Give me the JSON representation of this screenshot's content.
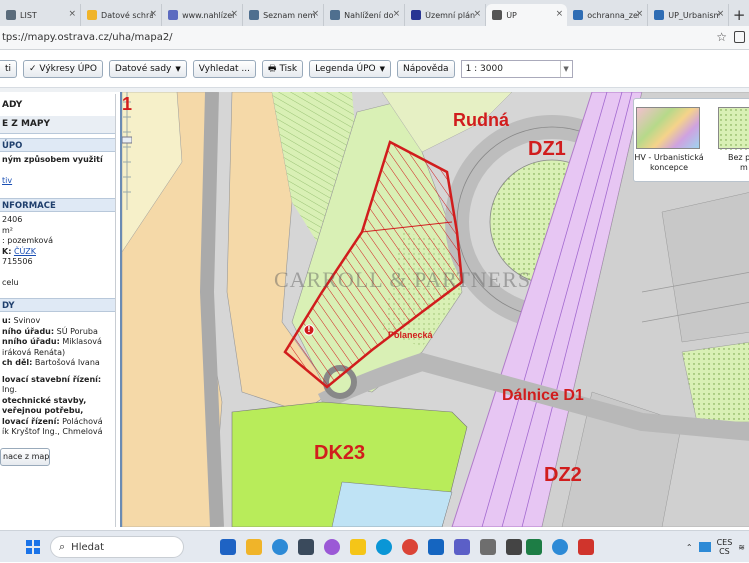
{
  "browser": {
    "tabs": [
      {
        "label": "LIST",
        "color": "#5a6b7b",
        "active": false
      },
      {
        "label": "Datové schrán",
        "color": "#f0b429",
        "active": false
      },
      {
        "label": "www.nahlízen",
        "color": "#5c6bc0",
        "active": false
      },
      {
        "label": "Seznam nemo",
        "color": "#4f6f8f",
        "active": false
      },
      {
        "label": "Nahlížení do k",
        "color": "#4f6f8f",
        "active": false
      },
      {
        "label": "Územní plán C",
        "color": "#283593",
        "active": false
      },
      {
        "label": "ÚP",
        "color": "#555555",
        "active": true
      },
      {
        "label": "ochranna_zele",
        "color": "#2f6db4",
        "active": false
      },
      {
        "label": "UP_Urbanism",
        "color": "#2f6db4",
        "active": false
      }
    ],
    "new_tab": "+",
    "url": "tps://mapy.ostrava.cz/uha/mapa2/"
  },
  "toolbar": {
    "buttons": [
      {
        "label": "ti",
        "has_caret": false
      },
      {
        "label": "✓ Výkresy ÚPO",
        "has_caret": false
      },
      {
        "label": "Datové sady",
        "has_caret": true
      },
      {
        "label": "Vyhledat ...",
        "has_caret": false
      },
      {
        "label": "Tisk",
        "has_caret": false,
        "icon": "printer-icon"
      },
      {
        "label": "Legenda ÚPO",
        "has_caret": true
      },
      {
        "label": "Nápověda",
        "has_caret": false
      }
    ],
    "scale": "1 : 3000"
  },
  "left_panel": {
    "title": "ADY",
    "main_header": "E Z MAPY",
    "section1_header": "ÚPO",
    "section1_lines": [
      "ným způsobem využití"
    ],
    "section1_link": "tiv",
    "section2_header": "NFORMACE",
    "section2_lines": [
      "2406",
      "m²",
      ": pozemková"
    ],
    "section2_k_label": "K:",
    "section2_k_link": "ČÚZK",
    "section2_lines_b": [
      "715506",
      "",
      "celu"
    ],
    "section3_header": "DY",
    "section3_lines": [
      {
        "b": "u:",
        "t": " Svinov"
      },
      {
        "b": "ního úřadu:",
        "t": " SÚ Poruba"
      },
      {
        "b": "nního úřadu:",
        "t": " Miklasová"
      },
      {
        "b": "",
        "t": "iráková Renáta)"
      },
      {
        "b": "ch děl:",
        "t": " Bartošová Ivana"
      },
      {
        "b": "",
        "t": ""
      },
      {
        "b": "lovací stavební řízení:",
        "t": ""
      },
      {
        "b": "",
        "t": "Ing."
      },
      {
        "b": "otechnické stavby,",
        "t": ""
      },
      {
        "b": "veřejnou potřebu,",
        "t": ""
      },
      {
        "b": "lovací řízení:",
        "t": " Poláchová"
      },
      {
        "b": "",
        "t": "ík Kryštof Ing., Chmelová"
      }
    ],
    "button": "nace z mapy"
  },
  "map": {
    "labels": {
      "rudna": "Rudná",
      "dz1": "DZ1",
      "dk23": "DK23",
      "dalnice": "Dálnice D1",
      "dz2": "DZ2",
      "polanecka": "Polanecká",
      "corner": "1"
    },
    "marker": "!",
    "watermark": "CARROLL & PARTNERS",
    "thumbnails": [
      {
        "caption_line1": "HV - Urbanistická",
        "caption_line2": "koncepce"
      },
      {
        "caption_line1": "Bez p",
        "caption_line2": "m"
      }
    ],
    "colors": {
      "background": "#d6d6d6",
      "residential": "#f5d9a8",
      "green": "#d9f0b5",
      "bright_green": "#b8ec5a",
      "highway": "#e7c6f3",
      "water": "#bfe3f5",
      "outline": "#d11d1d"
    }
  },
  "taskbar": {
    "search_placeholder": "Hledat",
    "lang_line1": "CES",
    "lang_line2": "CS"
  }
}
